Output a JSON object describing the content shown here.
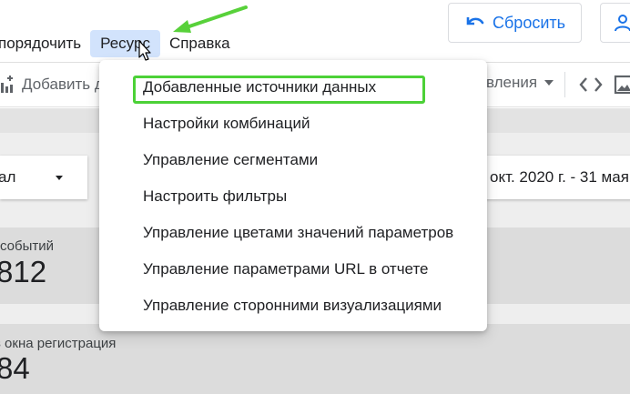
{
  "header": {
    "reset_label": "Сбросить",
    "menu": [
      "порядочить",
      "Ресурс",
      "Справка"
    ],
    "active_menu": "Ресурс"
  },
  "toolbar": {
    "add_data_label": "Добавить д",
    "manage_label": "вления"
  },
  "canvas": {
    "filter_label": "ал",
    "date_range": "окт. 2020 г. - 31 мая",
    "scorecards": [
      {
        "label": "событий",
        "value": "812"
      },
      {
        "label": "з окна регистрация",
        "value": "84"
      }
    ]
  },
  "resource_menu": {
    "items": [
      "Добавленные источники данных",
      "Настройки комбинаций",
      "Управление сегментами",
      "Настроить фильтры",
      "Управление цветами значений параметров",
      "Управление параметрами URL в отчете",
      "Управление сторонними визуализациями"
    ],
    "highlighted_index": 0
  },
  "colors": {
    "accent": "#1a73e8",
    "active_menu_bg": "#d2e3fc",
    "highlight_green": "#4cd137"
  },
  "icons": [
    "undo-icon",
    "person-icon",
    "add-chart-icon",
    "chevron-down-icon",
    "code-icon",
    "image-icon",
    "green-arrow-annotation",
    "mouse-cursor"
  ]
}
